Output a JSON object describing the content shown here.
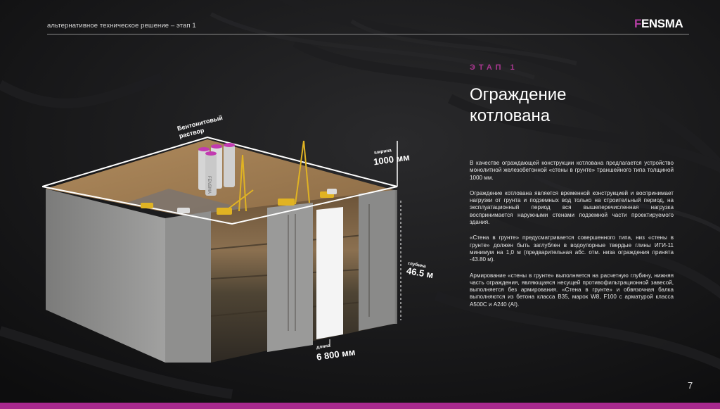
{
  "header": {
    "subtitle": "альтернативное техническое решение – этап 1",
    "logo_f": "F",
    "logo_rest": "ENSMA"
  },
  "stage": "ЭТАП 1",
  "title": "Ограждение котлована",
  "paragraphs": [
    "В качестве ограждающей конструкции котлована предлагается устройство монолитной железобетонной «стены в грунте» траншейного типа толщиной 1000 мм.",
    "Ограждение котлована является временной конструкцией и воспринимает нагрузки от грунта и подземных вод только на строительный период, на эксплуатационный период вся вышеперечисленная нагрузка воспринимается наружными стенами подземной части проектируемого здания.",
    "«Стена в грунте» предусматривается совершенного типа, низ «стены в грунте» должен быть заглублен в водоупорные твердые глины ИГИ-11 минимум на 1,0 м (предварительная абс. отм. низа ограждения принята -43.80 м).",
    "Армирование «стены в грунте» выполняется на расчетную глубину, нижняя часть ограждения, являющаяся несущей противофильтрационной завесой, выполняется без армирования. «Стена в грунте» и обвязочная балка выполняются из бетона класса В35, марок W8, F100 с арматурой класса А500С и А240 (AI)."
  ],
  "illustration": {
    "bentonite_line1": "Бентонитовый",
    "bentonite_line2": "раствор",
    "width_label": "ширина",
    "width_value": "1000 мм",
    "depth_label": "глубина",
    "depth_value": "46.5 м",
    "length_label": "длина",
    "length_value": "6 800 мм",
    "tank_text": "FENSMA"
  },
  "page_number": "7",
  "colors": {
    "accent": "#a8378f",
    "background": "#121113"
  }
}
